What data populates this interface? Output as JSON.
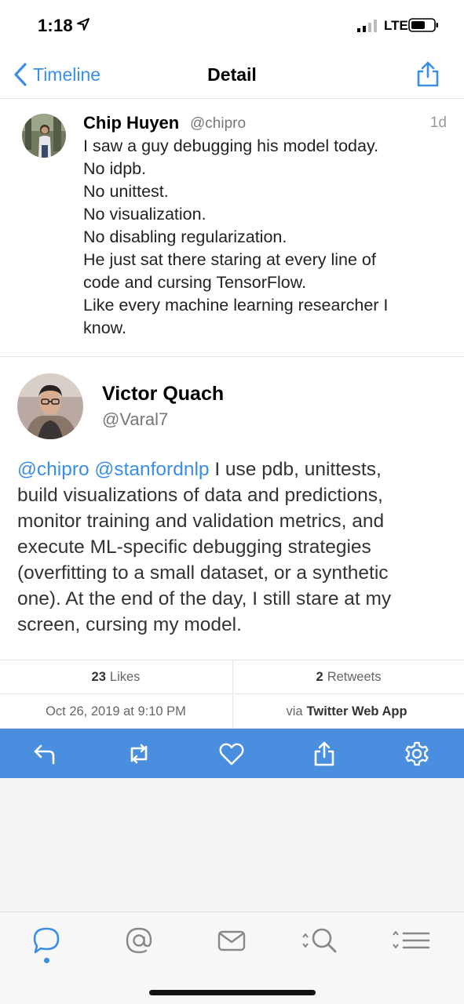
{
  "status_bar": {
    "time": "1:18",
    "network": "LTE"
  },
  "nav": {
    "back_label": "Timeline",
    "title": "Detail"
  },
  "parent_tweet": {
    "name": "Chip Huyen",
    "handle": "@chipro",
    "time": "1d",
    "lines": [
      "I saw a guy debugging his model today.",
      "No idpb.",
      "No unittest.",
      "No visualization.",
      "No disabling regularization.",
      "He just sat there staring at every line of",
      "code and cursing TensorFlow.",
      "Like every machine learning researcher I",
      "know."
    ]
  },
  "main_tweet": {
    "name": "Victor Quach",
    "handle": "@Varal7",
    "mention1": "@chipro",
    "mention2": "@stanfordnlp",
    "line1_rest": " I use pdb, unittests,",
    "lines": [
      "build visualizations of data and predictions,",
      "monitor training and validation metrics, and",
      "execute ML-specific debugging strategies",
      "(overfitting to a small dataset, or a synthetic",
      "one). At the end of the day, I still stare at my",
      "screen, cursing my model."
    ]
  },
  "stats": {
    "likes_count": "23",
    "likes_label": "Likes",
    "retweets_count": "2",
    "retweets_label": "Retweets",
    "date": "Oct 26, 2019 at 9:10 PM",
    "via_label": "via",
    "client": "Twitter Web App"
  },
  "actions": {
    "icons": [
      "reply-icon",
      "retweet-icon",
      "like-icon",
      "share-icon",
      "settings-icon"
    ]
  },
  "tabs": {
    "icons": [
      "timeline-icon",
      "mentions-icon",
      "messages-icon",
      "search-icon",
      "lists-icon"
    ],
    "active": "timeline-icon"
  },
  "colors": {
    "accent": "#3a8ee6",
    "action_bar": "#4a8ee0"
  }
}
